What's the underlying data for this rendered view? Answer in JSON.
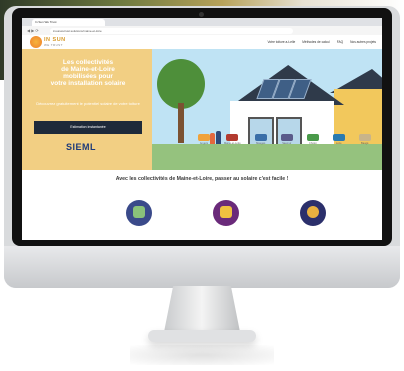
{
  "browser": {
    "tab_title": "In Sun We Trust",
    "url": "insunwetrust.solutions/maine-et-loire"
  },
  "site": {
    "logo_line1": "IN SUN",
    "logo_line2": "WE TRUST",
    "menu": [
      "Votre toiture a-t-elle",
      "Méthodes de calcul",
      "FAQ",
      "Nos autres projets"
    ]
  },
  "hero": {
    "title_lines": [
      "Les collectivités",
      "de Maine-et-Loire",
      "mobilisées pour",
      "votre installation solaire"
    ],
    "subtitle": "Découvrez gratuitement le potentiel solaire de votre toiture",
    "cta_label": "Estimation instantanée",
    "partner_logo": "SIEML"
  },
  "partners": [
    "Angers",
    "Maine-et-Loire",
    "Mauges",
    "Saumur",
    "Cholet",
    "Loire",
    "Baugé"
  ],
  "section": {
    "headline": "Avec les collectivités de Maine-et-Loire, passer au solaire c'est facile !"
  },
  "colors": {
    "hero_left_bg": "#f2cf83",
    "cta_bg": "#1e2a3a",
    "sky": "#bfe3f4"
  }
}
